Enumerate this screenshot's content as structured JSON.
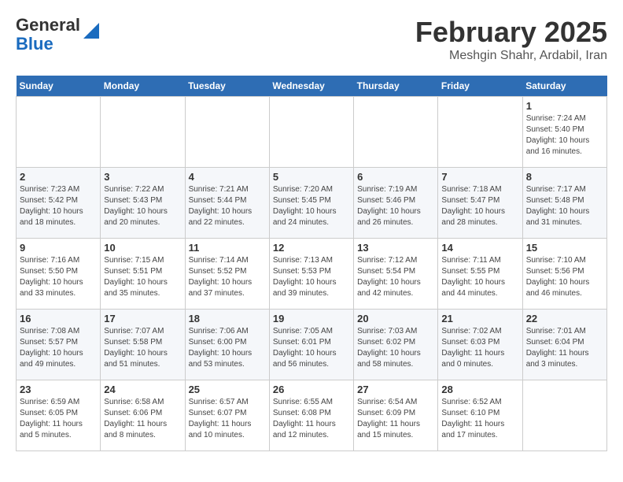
{
  "header": {
    "logo_line1": "General",
    "logo_line2": "Blue",
    "title": "February 2025",
    "subtitle": "Meshgin Shahr, Ardabil, Iran"
  },
  "days_of_week": [
    "Sunday",
    "Monday",
    "Tuesday",
    "Wednesday",
    "Thursday",
    "Friday",
    "Saturday"
  ],
  "weeks": [
    [
      {
        "day": "",
        "info": ""
      },
      {
        "day": "",
        "info": ""
      },
      {
        "day": "",
        "info": ""
      },
      {
        "day": "",
        "info": ""
      },
      {
        "day": "",
        "info": ""
      },
      {
        "day": "",
        "info": ""
      },
      {
        "day": "1",
        "info": "Sunrise: 7:24 AM\nSunset: 5:40 PM\nDaylight: 10 hours\nand 16 minutes."
      }
    ],
    [
      {
        "day": "2",
        "info": "Sunrise: 7:23 AM\nSunset: 5:42 PM\nDaylight: 10 hours\nand 18 minutes."
      },
      {
        "day": "3",
        "info": "Sunrise: 7:22 AM\nSunset: 5:43 PM\nDaylight: 10 hours\nand 20 minutes."
      },
      {
        "day": "4",
        "info": "Sunrise: 7:21 AM\nSunset: 5:44 PM\nDaylight: 10 hours\nand 22 minutes."
      },
      {
        "day": "5",
        "info": "Sunrise: 7:20 AM\nSunset: 5:45 PM\nDaylight: 10 hours\nand 24 minutes."
      },
      {
        "day": "6",
        "info": "Sunrise: 7:19 AM\nSunset: 5:46 PM\nDaylight: 10 hours\nand 26 minutes."
      },
      {
        "day": "7",
        "info": "Sunrise: 7:18 AM\nSunset: 5:47 PM\nDaylight: 10 hours\nand 28 minutes."
      },
      {
        "day": "8",
        "info": "Sunrise: 7:17 AM\nSunset: 5:48 PM\nDaylight: 10 hours\nand 31 minutes."
      }
    ],
    [
      {
        "day": "9",
        "info": "Sunrise: 7:16 AM\nSunset: 5:50 PM\nDaylight: 10 hours\nand 33 minutes."
      },
      {
        "day": "10",
        "info": "Sunrise: 7:15 AM\nSunset: 5:51 PM\nDaylight: 10 hours\nand 35 minutes."
      },
      {
        "day": "11",
        "info": "Sunrise: 7:14 AM\nSunset: 5:52 PM\nDaylight: 10 hours\nand 37 minutes."
      },
      {
        "day": "12",
        "info": "Sunrise: 7:13 AM\nSunset: 5:53 PM\nDaylight: 10 hours\nand 39 minutes."
      },
      {
        "day": "13",
        "info": "Sunrise: 7:12 AM\nSunset: 5:54 PM\nDaylight: 10 hours\nand 42 minutes."
      },
      {
        "day": "14",
        "info": "Sunrise: 7:11 AM\nSunset: 5:55 PM\nDaylight: 10 hours\nand 44 minutes."
      },
      {
        "day": "15",
        "info": "Sunrise: 7:10 AM\nSunset: 5:56 PM\nDaylight: 10 hours\nand 46 minutes."
      }
    ],
    [
      {
        "day": "16",
        "info": "Sunrise: 7:08 AM\nSunset: 5:57 PM\nDaylight: 10 hours\nand 49 minutes."
      },
      {
        "day": "17",
        "info": "Sunrise: 7:07 AM\nSunset: 5:58 PM\nDaylight: 10 hours\nand 51 minutes."
      },
      {
        "day": "18",
        "info": "Sunrise: 7:06 AM\nSunset: 6:00 PM\nDaylight: 10 hours\nand 53 minutes."
      },
      {
        "day": "19",
        "info": "Sunrise: 7:05 AM\nSunset: 6:01 PM\nDaylight: 10 hours\nand 56 minutes."
      },
      {
        "day": "20",
        "info": "Sunrise: 7:03 AM\nSunset: 6:02 PM\nDaylight: 10 hours\nand 58 minutes."
      },
      {
        "day": "21",
        "info": "Sunrise: 7:02 AM\nSunset: 6:03 PM\nDaylight: 11 hours\nand 0 minutes."
      },
      {
        "day": "22",
        "info": "Sunrise: 7:01 AM\nSunset: 6:04 PM\nDaylight: 11 hours\nand 3 minutes."
      }
    ],
    [
      {
        "day": "23",
        "info": "Sunrise: 6:59 AM\nSunset: 6:05 PM\nDaylight: 11 hours\nand 5 minutes."
      },
      {
        "day": "24",
        "info": "Sunrise: 6:58 AM\nSunset: 6:06 PM\nDaylight: 11 hours\nand 8 minutes."
      },
      {
        "day": "25",
        "info": "Sunrise: 6:57 AM\nSunset: 6:07 PM\nDaylight: 11 hours\nand 10 minutes."
      },
      {
        "day": "26",
        "info": "Sunrise: 6:55 AM\nSunset: 6:08 PM\nDaylight: 11 hours\nand 12 minutes."
      },
      {
        "day": "27",
        "info": "Sunrise: 6:54 AM\nSunset: 6:09 PM\nDaylight: 11 hours\nand 15 minutes."
      },
      {
        "day": "28",
        "info": "Sunrise: 6:52 AM\nSunset: 6:10 PM\nDaylight: 11 hours\nand 17 minutes."
      },
      {
        "day": "",
        "info": ""
      }
    ]
  ]
}
